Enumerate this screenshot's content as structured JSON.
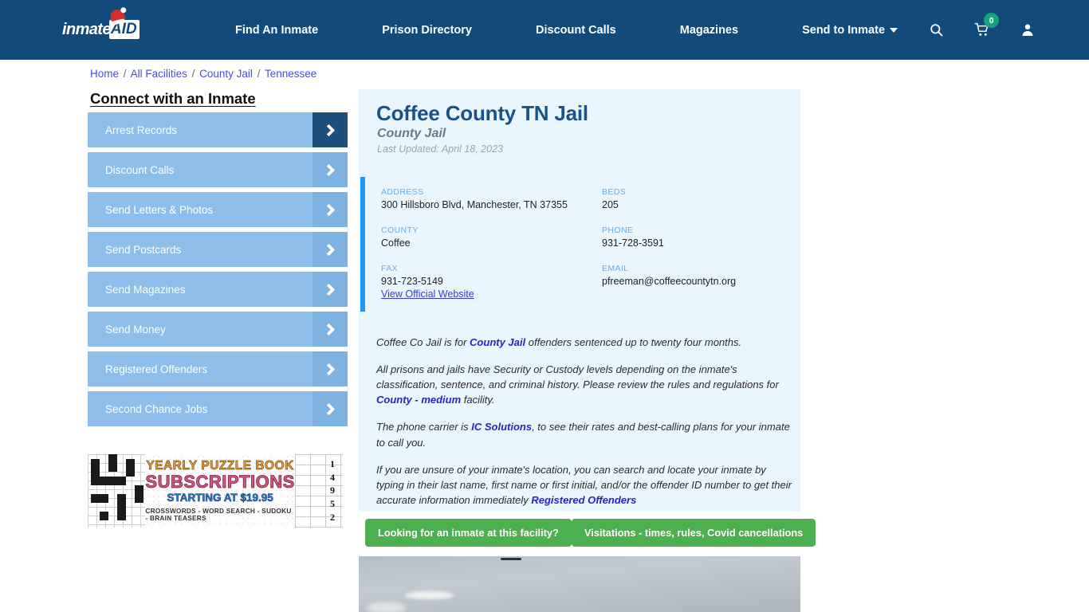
{
  "header": {
    "logo_text": "inmate",
    "logo_badge": "AID",
    "nav": [
      {
        "label": "Find An Inmate",
        "name": "nav-find-an-inmate"
      },
      {
        "label": "Prison Directory",
        "name": "nav-prison-directory"
      },
      {
        "label": "Discount Calls",
        "name": "nav-discount-calls"
      },
      {
        "label": "Magazines",
        "name": "nav-magazines"
      },
      {
        "label": "Send to Inmate",
        "name": "nav-send-to-inmate",
        "has_caret": true
      }
    ],
    "search_icon": "search-icon",
    "cart_icon": "cart-icon",
    "cart_count": "0",
    "account_icon": "user-account-icon"
  },
  "breadcrumb": {
    "items": [
      "Home",
      "All Facilities",
      "County Jail",
      "Tennessee"
    ],
    "separator": "/"
  },
  "sidebar": {
    "title": "Connect with an Inmate",
    "items": [
      {
        "label": "Arrest Records",
        "name": "sidebar-item-arrest-records",
        "active": true
      },
      {
        "label": "Discount Calls",
        "name": "sidebar-item-discount-calls",
        "active": false
      },
      {
        "label": "Send Letters & Photos",
        "name": "sidebar-item-send-letters-photos",
        "active": false
      },
      {
        "label": "Send Postcards",
        "name": "sidebar-item-send-postcards",
        "active": false
      },
      {
        "label": "Send Magazines",
        "name": "sidebar-item-send-magazines",
        "active": false
      },
      {
        "label": "Send Money",
        "name": "sidebar-item-send-money",
        "active": false
      },
      {
        "label": "Registered Offenders",
        "name": "sidebar-item-registered-offenders",
        "active": false
      },
      {
        "label": "Second Chance Jobs",
        "name": "sidebar-item-second-chance-jobs",
        "active": false
      }
    ]
  },
  "ad": {
    "line1": "YEARLY PUZZLE BOOK",
    "line2": "SUBSCRIPTIONS",
    "line3": "STARTING AT $19.95",
    "line4": "CROSSWORDS - WORD SEARCH - SUDOKU - BRAIN TEASERS",
    "sudoku_digits": [
      "1",
      "4",
      "9",
      "5",
      "2"
    ]
  },
  "facility": {
    "title": "Coffee County TN Jail",
    "subtitle": "County Jail",
    "last_updated": "Last Updated: April 18, 2023",
    "fields": [
      {
        "label": "ADDRESS",
        "value": "300 Hillsboro Blvd, Manchester, TN 37355",
        "name": "facility-address"
      },
      {
        "label": "BEDS",
        "value": "205",
        "name": "facility-beds"
      },
      {
        "label": "COUNTY",
        "value": "Coffee",
        "name": "facility-county"
      },
      {
        "label": "PHONE",
        "value": "931-728-3591",
        "name": "facility-phone"
      },
      {
        "label": "FAX",
        "value": "931-723-5149",
        "name": "facility-fax"
      },
      {
        "label": "EMAIL",
        "value": "pfreeman@coffeecountytn.org",
        "name": "facility-email"
      }
    ],
    "official_website_link": "View Official Website"
  },
  "description": {
    "p1_a": "Coffee Co Jail is for ",
    "p1_link": "County Jail",
    "p1_b": " offenders sentenced up to twenty four months.",
    "p2_a": "All prisons and jails have Security or Custody levels depending on the inmate's classification, sentence, and criminal history. Please review the rules and regulations for ",
    "p2_link": "County - medium",
    "p2_b": " facility.",
    "p3_a": "The phone carrier is ",
    "p3_link": "IC Solutions",
    "p3_b": ", to see their rates and best-calling plans for your inmate to call you.",
    "p4_a": "If you are unsure of your inmate's location, you can search and locate your inmate by typing in their last name, first name or first initial, and/or the offender ID number to get their accurate information immediately ",
    "p4_link": "Registered Offenders"
  },
  "actions": {
    "inmate_search": "Looking for an inmate at this facility?",
    "visitations": "Visitations - times, rules, Covid cancellations"
  },
  "colors": {
    "header_bg": "#114a7b",
    "card_bg": "#eaf6fd",
    "accent_blue": "#2196f3",
    "sidebar_btn": "#8dbde8",
    "sidebar_btn_active_arrow": "#1d4f7c",
    "green_button": "#4caf50",
    "cart_badge": "#13a47a",
    "title_blue": "#17528b",
    "link_blue": "#2424cf"
  }
}
